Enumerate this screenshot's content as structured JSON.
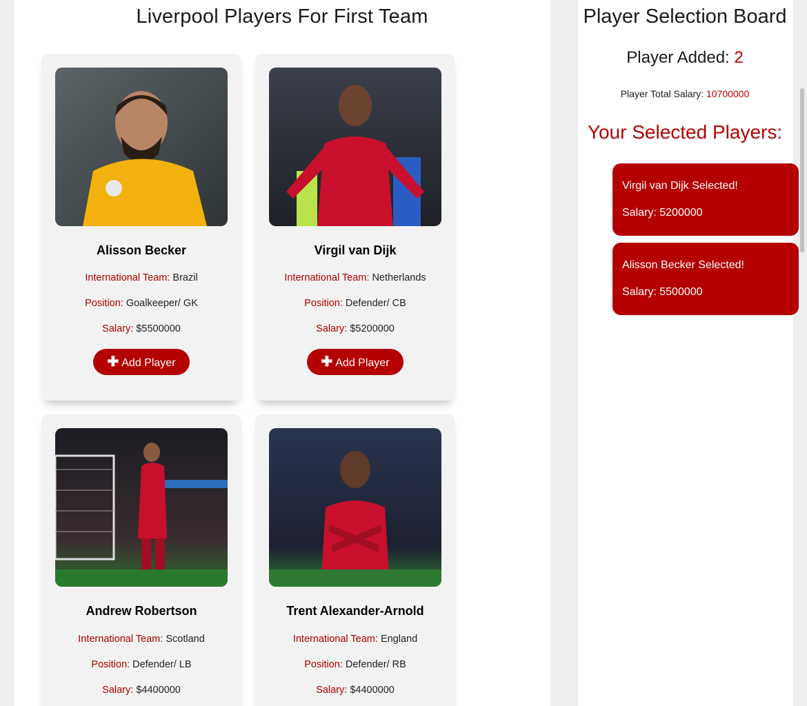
{
  "main": {
    "title": "Liverpool Players For First Team",
    "labels": {
      "team": "International Team:",
      "position": "Position:",
      "salary": "Salary:"
    },
    "add_label": "Add Player",
    "players": [
      {
        "name": "Alisson Becker",
        "team": "Brazil",
        "position": "Goalkeeper/ GK",
        "salary": "$5500000",
        "photo": "goalkeeper-photo"
      },
      {
        "name": "Virgil van Dijk",
        "team": "Netherlands",
        "position": "Defender/ CB",
        "salary": "$5200000",
        "photo": "defender-celebration-photo"
      },
      {
        "name": "Andrew Robertson",
        "team": "Scotland",
        "position": "Defender/ LB",
        "salary": "$4400000",
        "photo": "stadium-celebration-photo"
      },
      {
        "name": "Trent Alexander-Arnold",
        "team": "England",
        "position": "Defender/ RB",
        "salary": "$4400000",
        "photo": "arms-crossed-celebration-photo"
      }
    ]
  },
  "board": {
    "title": "Player Selection Board",
    "added_label": "Player Added:",
    "added_count": "2",
    "total_label": "Player Total Salary:",
    "total_value": "10700000",
    "selected_heading": "Your Selected Players:",
    "selected": [
      {
        "title": "Virgil van Dijk Selected!",
        "salary": "Salary: 5200000"
      },
      {
        "title": "Alisson Becker Selected!",
        "salary": "Salary: 5500000"
      }
    ]
  },
  "colors": {
    "accent": "#b50000",
    "card_bg": "#f2f2f2",
    "page_bg": "#eeeeee"
  }
}
